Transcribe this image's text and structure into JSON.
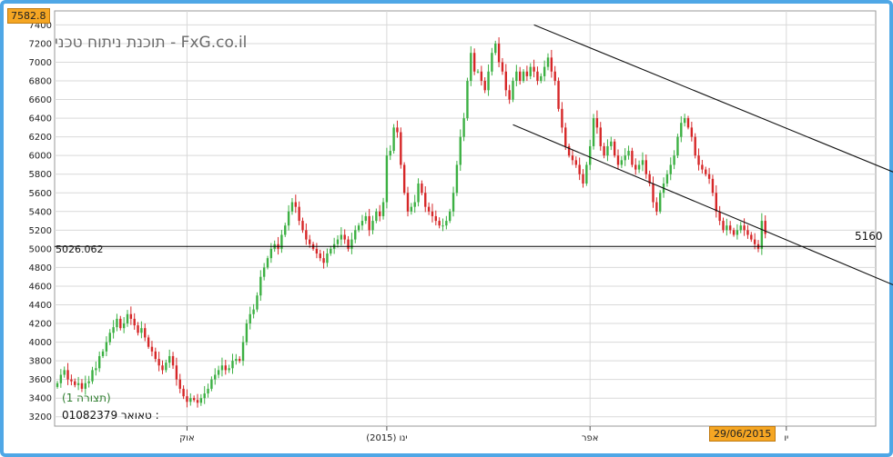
{
  "watermark": "תוכנת ניתוח טכני - FxG.co.il",
  "top_badge": "7582.8",
  "date_badge": "29/06/2015",
  "level_label": "5026.062",
  "last_price_label": "5160",
  "chart_label": "(תצורה 1)",
  "ticker": {
    "label": "טאואר :",
    "code": "01082379"
  },
  "colors": {
    "up": "#3cb043",
    "down": "#d62728",
    "frame": "#4fa7e6",
    "badge": "#f5a623",
    "grid": "#d9d9d9"
  },
  "chart_data": {
    "type": "candlestick",
    "y_ticks": [
      3200,
      3400,
      3600,
      3800,
      4000,
      4200,
      4400,
      4600,
      4800,
      5000,
      5200,
      5400,
      5600,
      5800,
      6000,
      6200,
      6400,
      6600,
      6800,
      7000,
      7200,
      7400
    ],
    "ylim": [
      3100,
      7550
    ],
    "x_ticks": [
      {
        "label": "אוק",
        "index": 37
      },
      {
        "label": "(2015) ינו",
        "index": 94
      },
      {
        "label": "אפר",
        "index": 152
      },
      {
        "label": "יו",
        "index": 208
      }
    ],
    "horizontal_level": 5026.062,
    "last_price": 5160,
    "trend_lines": [
      {
        "name": "upper",
        "from": [
          136,
          7400
        ],
        "to": [
          240,
          5800
        ]
      },
      {
        "name": "lower",
        "from": [
          130,
          6330
        ],
        "to": [
          240,
          4590
        ]
      }
    ],
    "closes": [
      3560,
      3650,
      3700,
      3600,
      3580,
      3540,
      3560,
      3500,
      3560,
      3580,
      3700,
      3720,
      3850,
      3900,
      4000,
      4100,
      4160,
      4250,
      4150,
      4200,
      4300,
      4250,
      4180,
      4100,
      4150,
      4050,
      3950,
      3900,
      3820,
      3750,
      3700,
      3780,
      3850,
      3750,
      3600,
      3500,
      3420,
      3360,
      3400,
      3380,
      3350,
      3400,
      3450,
      3500,
      3600,
      3650,
      3700,
      3750,
      3700,
      3720,
      3800,
      3820,
      3800,
      4000,
      4200,
      4300,
      4350,
      4500,
      4700,
      4800,
      4900,
      5000,
      5050,
      5000,
      5150,
      5250,
      5400,
      5500,
      5450,
      5300,
      5200,
      5100,
      5050,
      5000,
      4950,
      4900,
      4850,
      4950,
      5000,
      5050,
      5100,
      5150,
      5100,
      5000,
      5100,
      5200,
      5250,
      5300,
      5350,
      5200,
      5300,
      5400,
      5350,
      5500,
      6000,
      6050,
      6300,
      6250,
      5900,
      5600,
      5400,
      5450,
      5500,
      5700,
      5600,
      5450,
      5400,
      5350,
      5300,
      5250,
      5250,
      5300,
      5400,
      5600,
      5900,
      6200,
      6400,
      6800,
      7100,
      6900,
      6900,
      6800,
      6700,
      6900,
      7100,
      7200,
      7000,
      6900,
      6700,
      6600,
      6800,
      6900,
      6800,
      6900,
      6850,
      6950,
      6900,
      6800,
      6850,
      6950,
      7050,
      6900,
      6800,
      6500,
      6300,
      6100,
      6000,
      5950,
      5900,
      5800,
      5700,
      5900,
      6100,
      6400,
      6300,
      6100,
      6000,
      6100,
      6150,
      6000,
      5900,
      5950,
      6000,
      6050,
      5900,
      5850,
      5900,
      5950,
      5800,
      5700,
      5500,
      5400,
      5600,
      5700,
      5800,
      5900,
      6000,
      6200,
      6350,
      6400,
      6300,
      6200,
      6000,
      5900,
      5850,
      5800,
      5750,
      5600,
      5400,
      5300,
      5200,
      5250,
      5200,
      5150,
      5200,
      5250,
      5200,
      5150,
      5100,
      5050,
      5000,
      5300,
      5160
    ]
  }
}
